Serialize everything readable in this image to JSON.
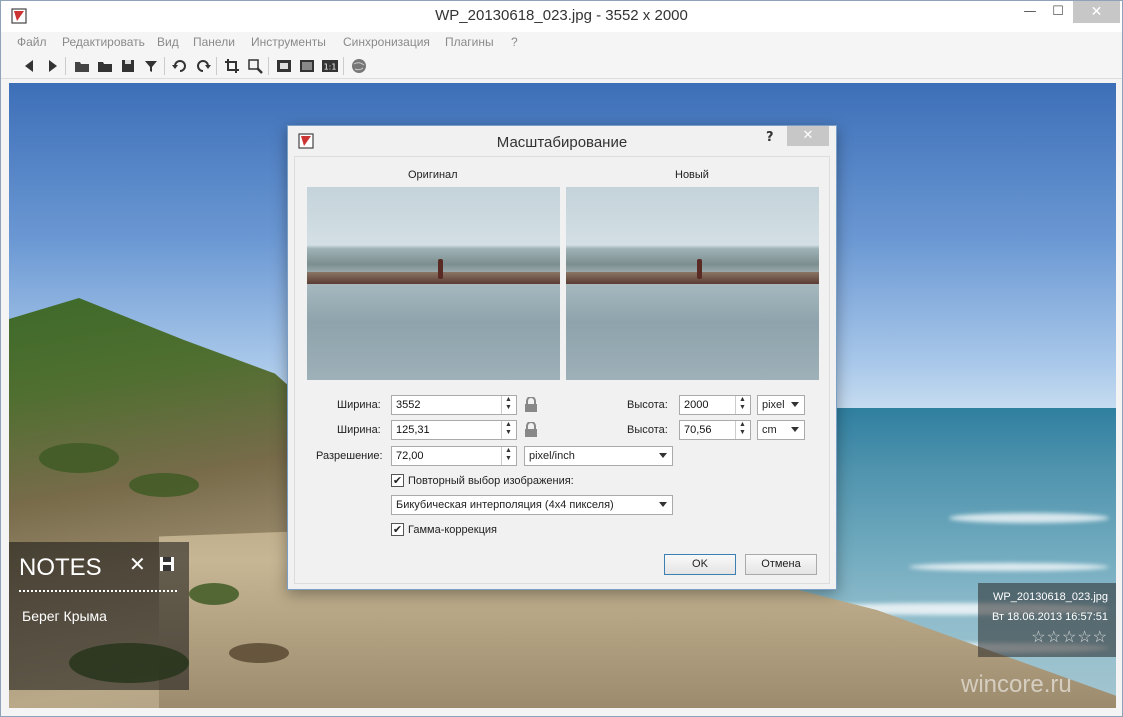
{
  "window": {
    "title": "WP_20130618_023.jpg  - 3552 x 2000",
    "minimize": "—",
    "maximize": "☐",
    "close": "✕"
  },
  "menu": [
    "Файл",
    "Редактировать",
    "Вид",
    "Панели",
    "Инструменты",
    "Синхронизация",
    "Плагины",
    "?"
  ],
  "toolbar_icons": [
    "back-icon",
    "forward-icon",
    "open-folder-icon",
    "folder-icon",
    "save-icon",
    "filter-icon",
    "rotate-left-icon",
    "rotate-right-icon",
    "crop-icon",
    "zoom-icon",
    "fit-icon",
    "fullscreen-icon",
    "actual-size-icon",
    "globe-icon"
  ],
  "toolbar": {
    "actual_size": "1:1"
  },
  "notes": {
    "title": "NOTES",
    "close": "✕",
    "text": "Берег Крыма"
  },
  "info": {
    "filename": "WP_20130618_023.jpg",
    "datetime": "Вт 18.06.2013 16:57:51",
    "rating_stars": "☆☆☆☆☆",
    "rating": 0
  },
  "watermark": "wincore.ru",
  "dialog": {
    "title": "Масштабирование",
    "help": "?",
    "close": "✕",
    "original_label": "Оригинал",
    "new_label": "Новый",
    "width_label": "Ширина:",
    "width_px": "3552",
    "width2_label": "Ширина:",
    "width_cm": "125,31",
    "height_label": "Высота:",
    "height_px": "2000",
    "height2_label": "Высота:",
    "height_cm": "70,56",
    "unit1": "pixel",
    "unit2": "cm",
    "resolution_label": "Разрешение:",
    "resolution": "72,00",
    "resolution_unit": "pixel/inch",
    "resample_label": "Повторный выбор изображения:",
    "resample_checked": true,
    "interpolation": "Бикубическая интерполяция (4x4 пикселя)",
    "gamma_label": "Гамма-коррекция",
    "gamma_checked": true,
    "ok": "OK",
    "cancel": "Отмена"
  },
  "colors": {
    "accent": "#3c7fb1",
    "close_btn": "#c7c7c7"
  }
}
